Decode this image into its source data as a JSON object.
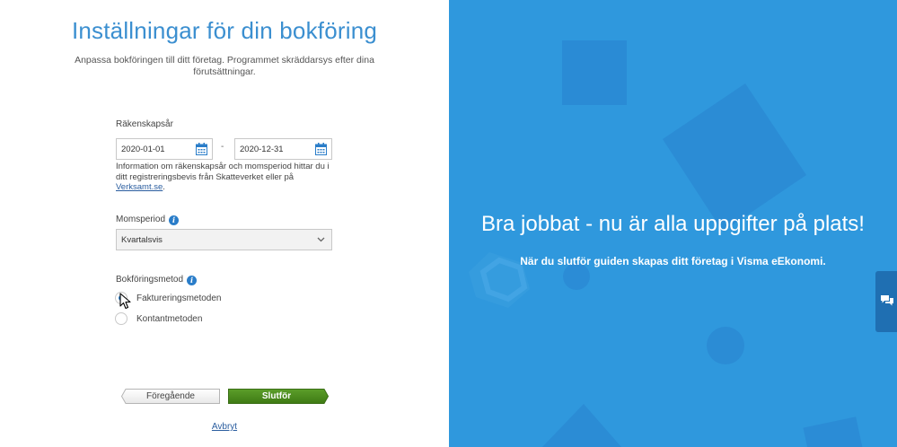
{
  "title": "Inställningar för din bokföring",
  "subtitle": "Anpassa bokföringen till ditt företag. Programmet skräddarsys efter dina förutsättningar.",
  "fiscal_year": {
    "label": "Räkenskapsår",
    "start": "2020-01-01",
    "end": "2020-12-31",
    "separator": "-",
    "help_text": "Information om räkenskapsår och momsperiod hittar du i ditt registreringsbevis från Skatteverket eller på",
    "help_link": "Verksamt.se",
    "help_end": "."
  },
  "vat_period": {
    "label": "Momsperiod",
    "selected": "Kvartalsvis"
  },
  "accounting_method": {
    "label": "Bokföringsmetod",
    "options": [
      {
        "label": "Faktureringsmetoden",
        "checked": true
      },
      {
        "label": "Kontantmetoden",
        "checked": false
      }
    ]
  },
  "buttons": {
    "previous": "Föregående",
    "finish": "Slutför",
    "cancel": "Avbryt"
  },
  "hero": {
    "title": "Bra jobbat - nu är alla uppgifter på plats!",
    "subtitle": "När du slutför guiden skapas ditt företag i Visma eEkonomi."
  },
  "icons": {
    "info": "info-icon",
    "calendar": "calendar-icon",
    "chevron": "chevron-down-icon",
    "chat": "chat-icon"
  },
  "colors": {
    "accent": "#2a7dc9",
    "title": "#3b8fd0",
    "finish_button": "#4a8a1e",
    "hero_bg": "#2f98dd"
  }
}
